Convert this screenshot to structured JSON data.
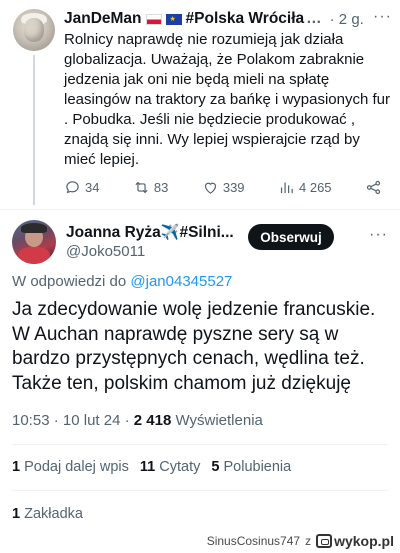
{
  "parent_tweet": {
    "display_name": "JanDeMan",
    "display_name_2": "#Polska Wróciła",
    "truncation": "…",
    "timestamp": "· 2 g.",
    "more": "···",
    "text": "Rolnicy naprawdę nie rozumieją jak działa globalizacja. Uważają, że Polakom zabraknie jedzenia jak oni nie będą mieli na spłatę leasingów na traktory za bańkę i wypasionych fur . Pobudka. Jeśli nie będziecie produkować , znajdą się inni. Wy lepiej wspierajcie rząd by mieć lepiej.",
    "replies": "34",
    "reposts": "83",
    "likes": "339",
    "views": "4 265"
  },
  "main_tweet": {
    "display_name": "Joanna Ryża",
    "display_name_suffix": "#Silni...",
    "handle": "@Joko5011",
    "follow_label": "Obserwuj",
    "more": "···",
    "reply_prefix": "W odpowiedzi do",
    "reply_handle": "@jan04345527",
    "text": "Ja zdecydowanie wolę jedzenie francuskie. W Auchan naprawdę pyszne sery są w bardzo przystępnych cenach, wędlina też. Także ten, polskim chamom już dziękuję",
    "time": "10:53",
    "date": "· 10 lut 24 ·",
    "views_count": "2 418",
    "views_label": "Wyświetlenia",
    "stats": {
      "reposts_count": "1",
      "reposts_label": "Podaj dalej wpis",
      "quotes_count": "11",
      "quotes_label": "Cytaty",
      "likes_count": "5",
      "likes_label": "Polubienia"
    },
    "bookmarks_count": "1",
    "bookmarks_label": "Zakładka"
  },
  "watermark": {
    "user": "SinusCosinus747",
    "z": "z",
    "site": "wykop.pl"
  },
  "colors": {
    "accent": "#1d9bf0",
    "text": "#0f1419",
    "muted": "#536471"
  }
}
